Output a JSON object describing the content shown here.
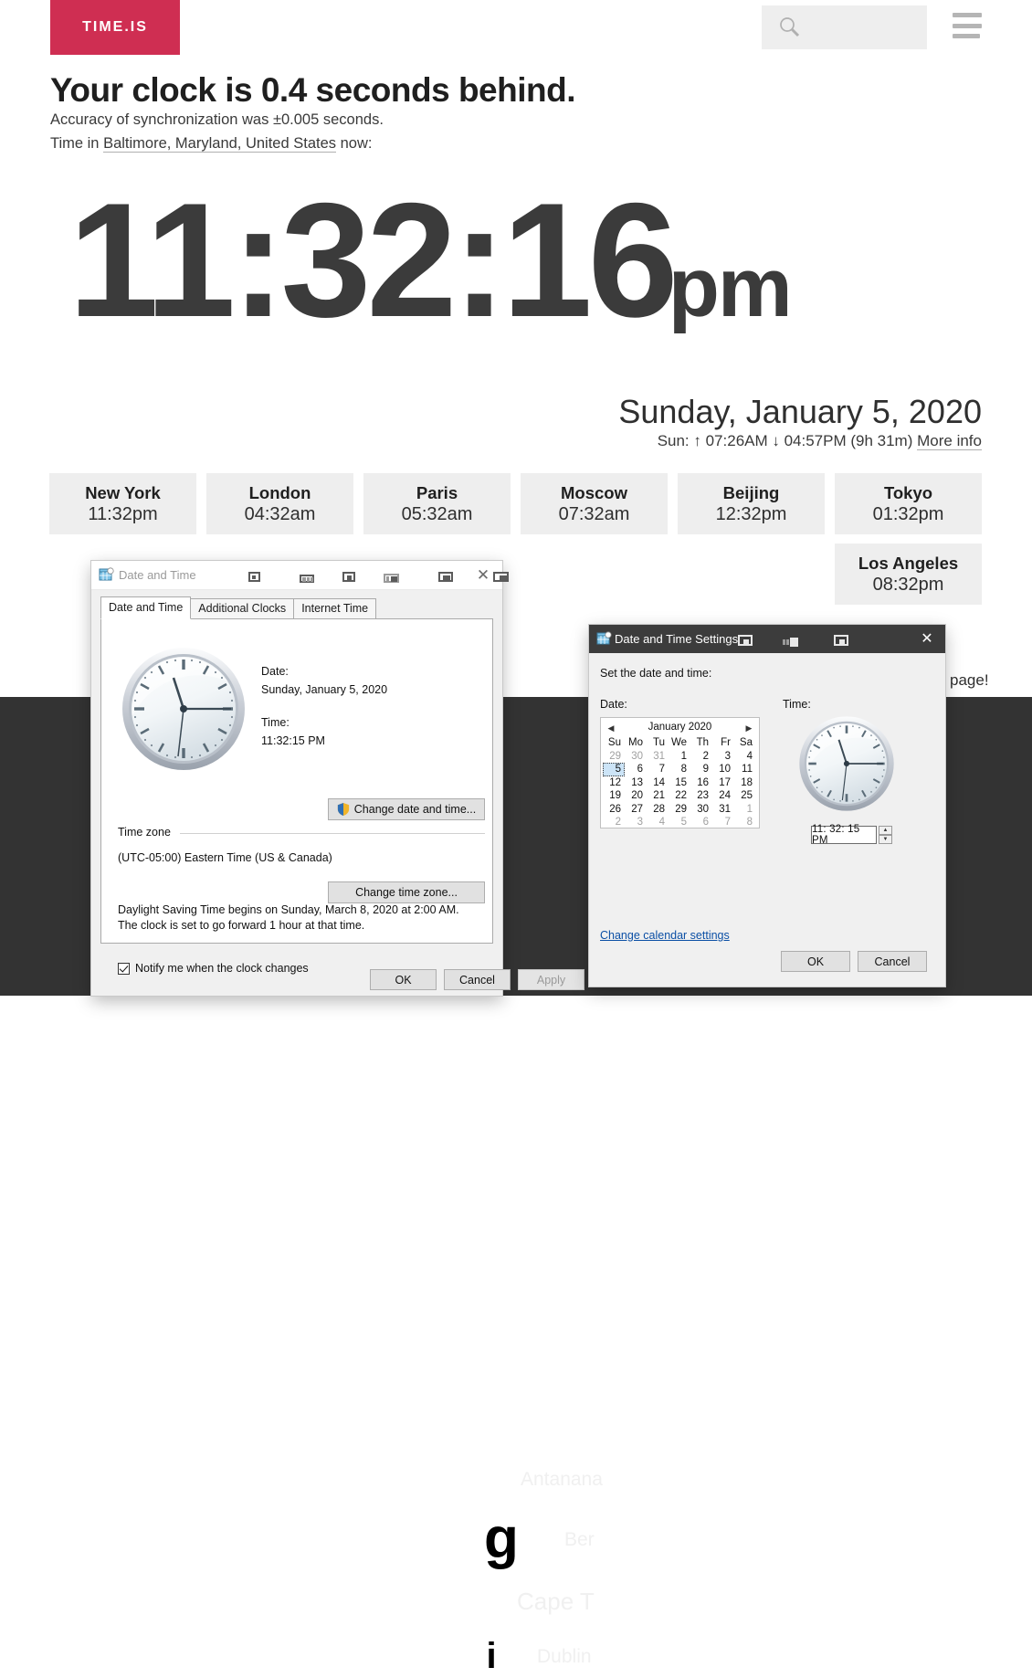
{
  "site": {
    "logo_text": "TIME.IS",
    "search_placeholder": "",
    "search_value": "",
    "search_icon": "search-icon",
    "menu_icon": "hamburger-menu-icon",
    "accent_color": "#cf2e52"
  },
  "main": {
    "headline": "Your clock is 0.4 seconds behind.",
    "accuracy": "Accuracy of synchronization was ±0.005 seconds.",
    "time_in_prefix": "Time in ",
    "location_link": "Baltimore, Maryland, United States",
    "time_in_suffix": " now:",
    "clock_hms": "11:32:16",
    "clock_ampm": "pm",
    "date_long": "Sunday, January 5, 2020",
    "sun_line": "Sun: ↑ 07:26AM ↓ 04:57PM (9h 31m)",
    "more_info": "More info",
    "page_tail": "page!"
  },
  "cities_row1": [
    {
      "name": "New York",
      "time": "11:32pm"
    },
    {
      "name": "London",
      "time": "04:32am"
    },
    {
      "name": "Paris",
      "time": "05:32am"
    },
    {
      "name": "Moscow",
      "time": "07:32am"
    },
    {
      "name": "Beijing",
      "time": "12:32pm"
    },
    {
      "name": "Tokyo",
      "time": "01:32pm"
    }
  ],
  "cities_row2": [
    {
      "name": "Los Angeles",
      "time": "08:32pm"
    }
  ],
  "footer_cities": {
    "antananarivo": "Antanana",
    "berlin": "Ber",
    "cape_town": "Cape T",
    "dublin": "Dublin",
    "badge_g": "g",
    "badge_i": "i"
  },
  "dialog_datetime": {
    "title": "Date and Time",
    "app_icon": "calendar-clock-icon",
    "close_icon": "close-icon",
    "tabs": [
      {
        "label": "Date and Time",
        "active": true
      },
      {
        "label": "Additional Clocks",
        "active": false
      },
      {
        "label": "Internet Time",
        "active": false
      }
    ],
    "clock_icon": "analog-clock-icon",
    "date_label": "Date:",
    "date_value": "Sunday, January 5, 2020",
    "time_label": "Time:",
    "time_value": "11:32:15 PM",
    "change_datetime_button": "Change date and time...",
    "shield_icon": "uac-shield-icon",
    "timezone_group": "Time zone",
    "timezone_value": "(UTC-05:00) Eastern Time (US & Canada)",
    "change_timezone_button": "Change time zone...",
    "dst_note": "Daylight Saving Time begins on Sunday, March 8, 2020 at 2:00 AM. The clock is set to go forward 1 hour at that time.",
    "notify_checkbox_label": "Notify me when the clock changes",
    "notify_checked": true,
    "ok": "OK",
    "cancel": "Cancel",
    "apply": "Apply"
  },
  "dialog_settings": {
    "title": "Date and Time Settings",
    "app_icon": "calendar-clock-icon",
    "close_icon": "close-icon",
    "prompt": "Set the date and time:",
    "date_label": "Date:",
    "time_label": "Time:",
    "calendar": {
      "month_title": "January 2020",
      "prev_icon": "chevron-left-icon",
      "next_icon": "chevron-right-icon",
      "day_headers": [
        "Su",
        "Mo",
        "Tu",
        "We",
        "Th",
        "Fr",
        "Sa"
      ],
      "weeks": [
        [
          {
            "d": "29",
            "o": true
          },
          {
            "d": "30",
            "o": true
          },
          {
            "d": "31",
            "o": true
          },
          {
            "d": "1"
          },
          {
            "d": "2"
          },
          {
            "d": "3"
          },
          {
            "d": "4"
          }
        ],
        [
          {
            "d": "5",
            "sel": true
          },
          {
            "d": "6"
          },
          {
            "d": "7"
          },
          {
            "d": "8"
          },
          {
            "d": "9"
          },
          {
            "d": "10"
          },
          {
            "d": "11"
          }
        ],
        [
          {
            "d": "12"
          },
          {
            "d": "13"
          },
          {
            "d": "14"
          },
          {
            "d": "15"
          },
          {
            "d": "16"
          },
          {
            "d": "17"
          },
          {
            "d": "18"
          }
        ],
        [
          {
            "d": "19"
          },
          {
            "d": "20"
          },
          {
            "d": "21"
          },
          {
            "d": "22"
          },
          {
            "d": "23"
          },
          {
            "d": "24"
          },
          {
            "d": "25"
          }
        ],
        [
          {
            "d": "26"
          },
          {
            "d": "27"
          },
          {
            "d": "28"
          },
          {
            "d": "29"
          },
          {
            "d": "30"
          },
          {
            "d": "31"
          },
          {
            "d": "1",
            "o": true
          }
        ],
        [
          {
            "d": "2",
            "o": true
          },
          {
            "d": "3",
            "o": true
          },
          {
            "d": "4",
            "o": true
          },
          {
            "d": "5",
            "o": true
          },
          {
            "d": "6",
            "o": true
          },
          {
            "d": "7",
            "o": true
          },
          {
            "d": "8",
            "o": true
          }
        ]
      ]
    },
    "clock_icon": "analog-clock-icon",
    "time_value": "11: 32: 15 PM",
    "spin_up_icon": "spinner-up-icon",
    "spin_down_icon": "spinner-down-icon",
    "calendar_settings_link": "Change calendar settings",
    "ok": "OK",
    "cancel": "Cancel"
  }
}
